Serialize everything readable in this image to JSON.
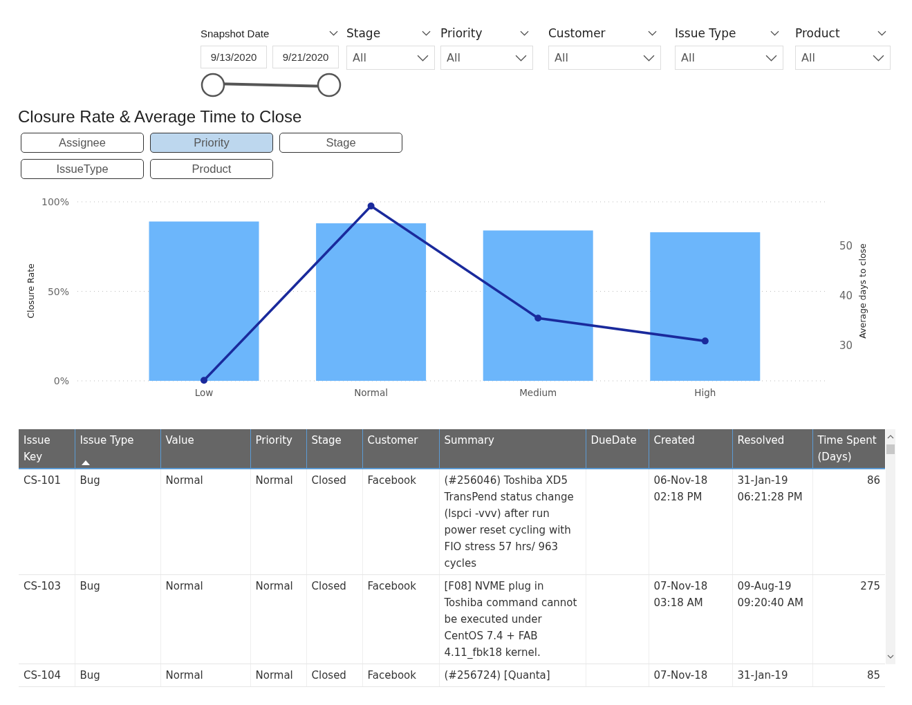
{
  "filters": {
    "snapshot": {
      "label": "Snapshot Date",
      "start": "9/13/2020",
      "end": "9/21/2020",
      "handles": [
        {
          "level": 0
        },
        {
          "level": 1
        }
      ]
    },
    "dropdowns": [
      {
        "label": "Stage",
        "value": "All"
      },
      {
        "label": "Priority",
        "value": "All"
      },
      {
        "label": "Customer",
        "value": "All"
      },
      {
        "label": "Issue Type",
        "value": "All"
      },
      {
        "label": "Product",
        "value": "All"
      }
    ]
  },
  "section_title": "Closure Rate & Average Time to Close",
  "group_buttons": [
    {
      "label": "Assignee",
      "selected": false
    },
    {
      "label": "Priority",
      "selected": true
    },
    {
      "label": "Stage",
      "selected": false
    },
    {
      "label": "IssueType",
      "selected": false
    },
    {
      "label": "Product",
      "selected": false
    }
  ],
  "chart_data": {
    "type": "bar",
    "ylabel": "Closure Rate",
    "y2label": "Average days to close",
    "categories": [
      "Low",
      "Normal",
      "Medium",
      "High"
    ],
    "ylim": [
      0,
      1
    ],
    "yticks": [
      {
        "value": 0,
        "label": "0%"
      },
      {
        "value": 0.5,
        "label": "50%"
      },
      {
        "value": 1,
        "label": "100%"
      }
    ],
    "y2lim": [
      22.8,
      58.75
    ],
    "y2ticks": [
      30,
      40,
      50
    ],
    "series": [
      {
        "color": "#6cb6fb",
        "values": [
          0.89,
          0.88,
          0.84,
          0.83
        ]
      },
      {
        "type": "line",
        "axis": "y2",
        "marker": true,
        "color": "#1a2a9c",
        "values": [
          22.9,
          57.9,
          35.4,
          30.8
        ]
      }
    ]
  },
  "table": {
    "columns": [
      {
        "label": "Issue Key",
        "sorted": false
      },
      {
        "label": "Issue Type",
        "sorted": true
      },
      {
        "label": "Value",
        "sorted": false
      },
      {
        "label": "Priority",
        "sorted": false
      },
      {
        "label": "Stage",
        "sorted": false
      },
      {
        "label": "Customer",
        "sorted": false
      },
      {
        "label": "Summary",
        "sorted": false
      },
      {
        "label": "DueDate",
        "sorted": false
      },
      {
        "label": "Created",
        "sorted": false
      },
      {
        "label": "Resolved",
        "sorted": false
      },
      {
        "label": "Time Spent (Days)",
        "sorted": false
      }
    ],
    "rows": [
      [
        "CS-101",
        "Bug",
        "Normal",
        "Normal",
        "Closed",
        "Facebook",
        "(#256046) Toshiba XD5 TransPend status change (lspci -vvv) after run power reset cycling with FIO stress 57 hrs/ 963 cycles",
        "",
        "06-Nov-18 02:18 PM",
        "31-Jan-19 06:21:28 PM",
        "86"
      ],
      [
        "CS-103",
        "Bug",
        "Normal",
        "Normal",
        "Closed",
        "Facebook",
        "[F08] NVME plug in Toshiba command cannot be executed under CentOS 7.4 + FAB 4.11_fbk18 kernel.",
        "",
        "07-Nov-18 03:18 AM",
        "09-Aug-19 09:20:40 AM",
        "275"
      ],
      [
        "CS-104",
        "Bug",
        "Normal",
        "Normal",
        "Closed",
        "Facebook",
        "(#256724) [Quanta]",
        "",
        "07-Nov-18",
        "31-Jan-19",
        "85"
      ]
    ]
  }
}
